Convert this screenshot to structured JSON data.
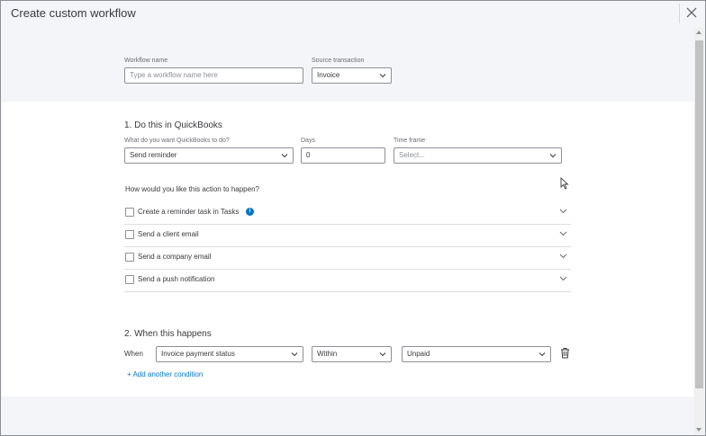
{
  "dialog": {
    "title": "Create custom workflow"
  },
  "header_fields": {
    "workflow_name_label": "Workflow name",
    "workflow_name_placeholder": "Type a workflow name here",
    "source_transaction_label": "Source transaction",
    "source_transaction_value": "Invoice"
  },
  "do_this": {
    "heading": "1. Do this in QuickBooks",
    "action_label": "What do you want QuickBooks to do?",
    "action_value": "Send reminder",
    "days_label": "Days",
    "days_value": "0",
    "time_frame_label": "Time frame",
    "time_frame_placeholder": "Select...",
    "question": "How would you like this action to happen?",
    "options": [
      {
        "label": "Create a reminder task in Tasks",
        "info": "i"
      },
      {
        "label": "Send a client email"
      },
      {
        "label": "Send a company email"
      },
      {
        "label": "Send a push notification"
      }
    ]
  },
  "when": {
    "heading": "2. When this happens",
    "when_label": "When",
    "condition_field": "Invoice payment status",
    "operator": "Within",
    "value": "Unpaid",
    "add_condition": "+ Add another condition"
  },
  "icons": {
    "close": "close-icon",
    "caret": "chevron-down-icon",
    "info": "info-icon",
    "trash": "trash-icon"
  },
  "colors": {
    "accent": "#0077c5",
    "text": "#393a3d",
    "border": "#8d9096",
    "panel_grey": "#f4f5f8"
  }
}
